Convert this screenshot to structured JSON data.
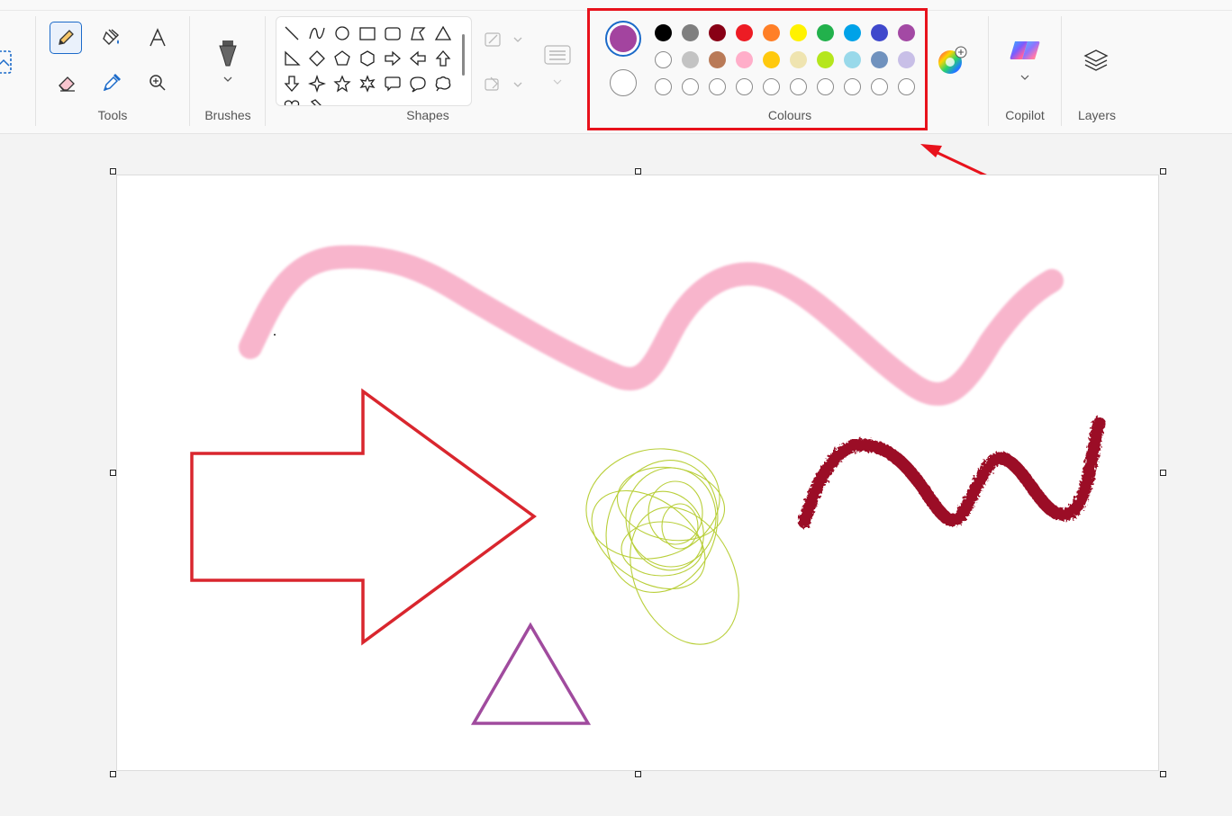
{
  "groups": {
    "tools_label": "Tools",
    "brushes_label": "Brushes",
    "shapes_label": "Shapes",
    "colours_label": "Colours",
    "copilot_label": "Copilot",
    "layers_label": "Layers"
  },
  "tools": [
    "pencil-icon",
    "fill-bucket-icon",
    "text-icon",
    "eraser-icon",
    "color-picker-icon",
    "magnifier-icon"
  ],
  "active_tool": "pencil",
  "colours": {
    "primary": "#a3449f",
    "secondary": "#ffffff",
    "palette_row1": [
      "#000000",
      "#7f7f7f",
      "#880015",
      "#ed1c24",
      "#ff7f27",
      "#fff200",
      "#22b14c",
      "#00a2e8",
      "#3f48cc",
      "#a349a4"
    ],
    "palette_row2": [
      "#ffffff",
      "#c3c3c3",
      "#b97a57",
      "#ffaec9",
      "#ffc90e",
      "#efe4b0",
      "#b5e61d",
      "#99d9ea",
      "#7092be",
      "#c8bfe7"
    ],
    "custom_slots": 10
  },
  "annotation": {
    "highlight_color": "#e8121c"
  },
  "canvas_strokes": {
    "pink_wave": "#f7a9c4",
    "red_arrow": "#d9262e",
    "lime_scribble": "#b9cf3a",
    "maroon_wave": "#9b0f26",
    "purple_triangle": "#a04b9e"
  }
}
